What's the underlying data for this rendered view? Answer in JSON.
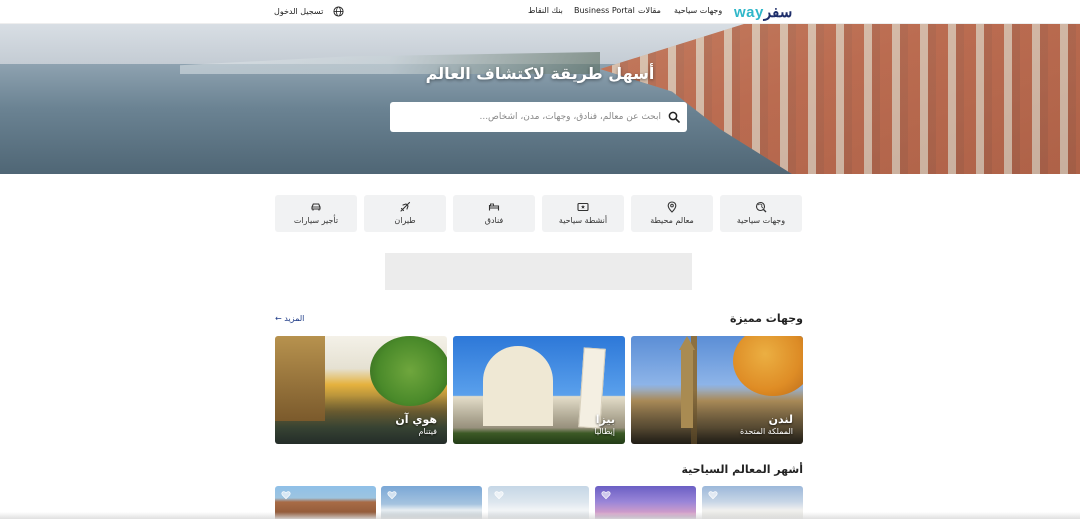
{
  "header": {
    "logo": {
      "part1": "way",
      "part2": "سفر"
    },
    "nav": [
      {
        "label": "وجهات سياحية"
      },
      {
        "label": "مقالات"
      },
      {
        "label": "Business Portal"
      },
      {
        "label": "بنك النقاط"
      }
    ],
    "language_icon": "globe-icon",
    "login_label": "تسجيل الدخول"
  },
  "hero": {
    "title": "أسهل طريقة لاكتشاف العالم",
    "search": {
      "placeholder": "ابحث عن معالم، فنادق، وجهات، مدن، أشخاص...",
      "value": ""
    }
  },
  "categories": [
    {
      "label": "وجهات سياحية",
      "icon": "globe-search-icon"
    },
    {
      "label": "معالم محيطة",
      "icon": "map-pin-icon"
    },
    {
      "label": "أنشطة سياحية",
      "icon": "ticket-icon"
    },
    {
      "label": "فنادق",
      "icon": "bed-icon"
    },
    {
      "label": "طيران",
      "icon": "plane-icon"
    },
    {
      "label": "تأجير سيارات",
      "icon": "car-icon"
    }
  ],
  "featured": {
    "title": "وجهات مميزة",
    "more_label": "المزيد",
    "cards": [
      {
        "name": "لندن",
        "country": "المملكة المتحدة"
      },
      {
        "name": "بيزا",
        "country": "إيطاليا"
      },
      {
        "name": "هوي آن",
        "country": "فيتنام"
      }
    ]
  },
  "attractions": {
    "title": "أشهر المعالم السياحية"
  },
  "colors": {
    "logo_teal": "#2fb7c9",
    "logo_navy": "#1f2f6b",
    "link_blue": "#1f3c88",
    "tile_bg": "#f1f2f3"
  }
}
